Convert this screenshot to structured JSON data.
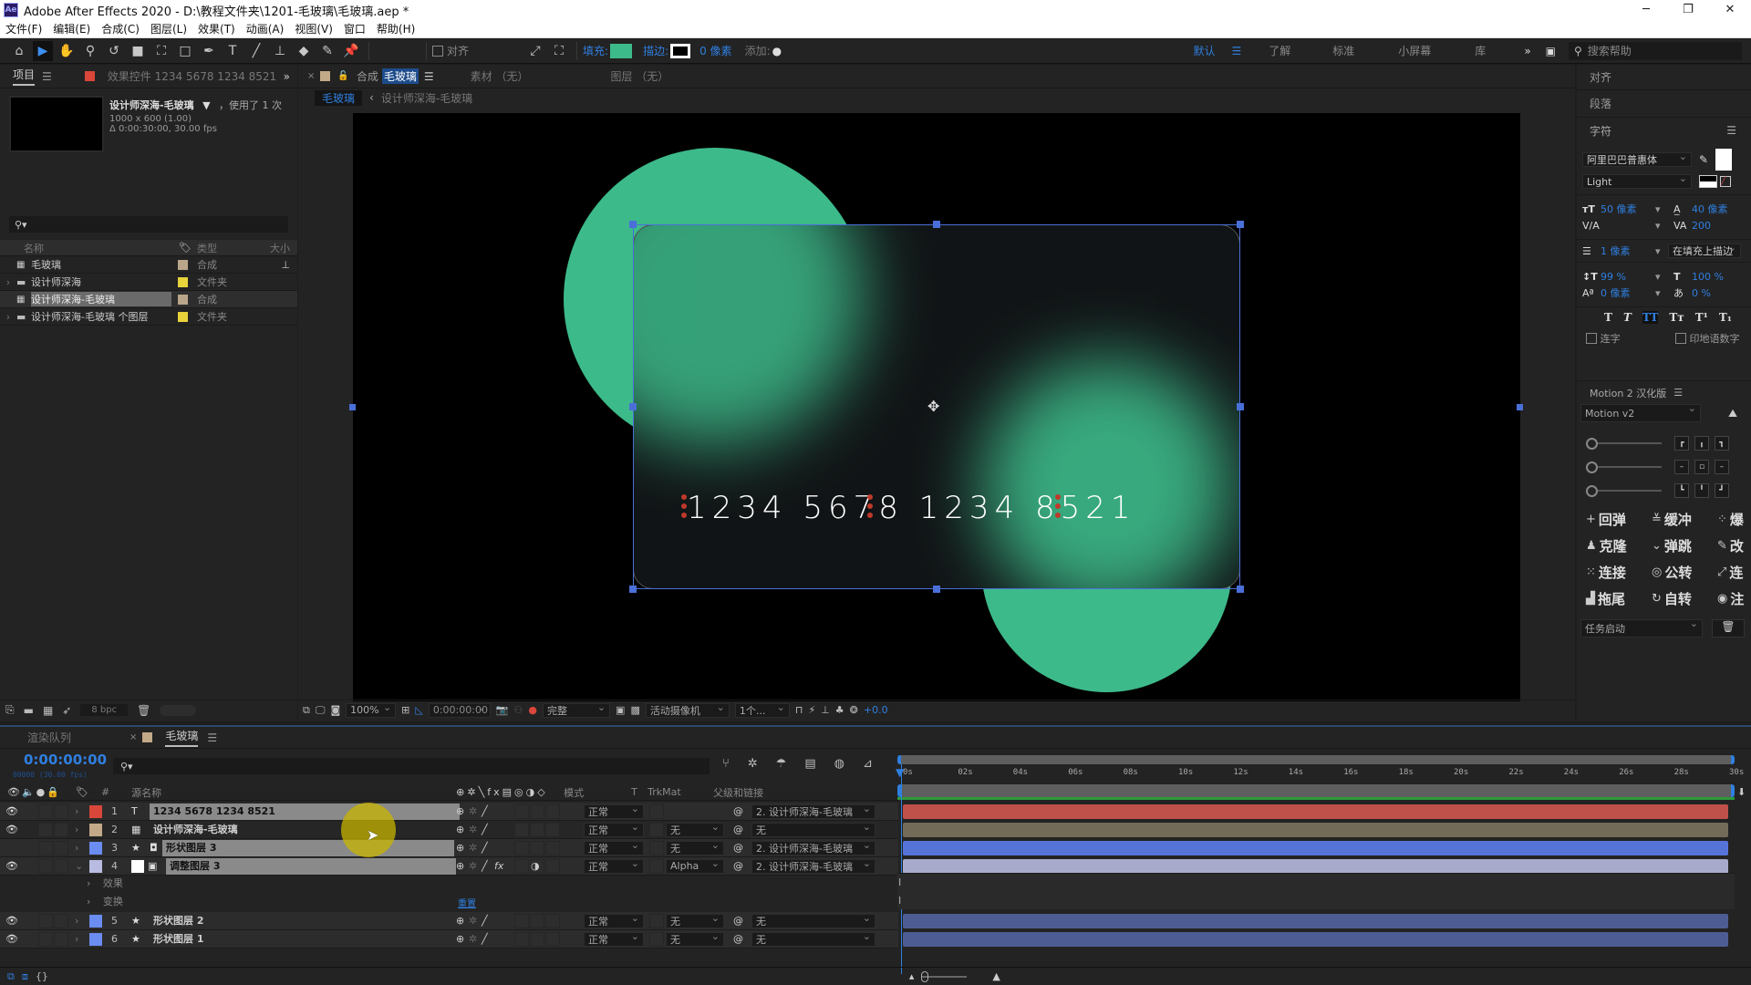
{
  "app": {
    "title": "Adobe After Effects 2020 - D:\\教程文件夹\\1201-毛玻璃\\毛玻璃.aep *",
    "logo": "Ae"
  },
  "window_controls": {
    "minimize": "─",
    "restore": "❐",
    "close": "✕"
  },
  "menu": [
    "文件(F)",
    "编辑(E)",
    "合成(C)",
    "图层(L)",
    "效果(T)",
    "动画(A)",
    "视图(V)",
    "窗口",
    "帮助(H)"
  ],
  "toolbar": {
    "tools": [
      {
        "name": "home-icon",
        "glyph": "⌂"
      },
      {
        "name": "selection-tool-icon",
        "glyph": "▶"
      },
      {
        "name": "hand-tool-icon",
        "glyph": "✋"
      },
      {
        "name": "zoom-tool-icon",
        "glyph": "⚲"
      },
      {
        "name": "rotate-tool-icon",
        "glyph": "↺"
      },
      {
        "name": "camera-tool-icon",
        "glyph": "■"
      },
      {
        "name": "pan-behind-tool-icon",
        "glyph": "⛶"
      },
      {
        "name": "rectangle-tool-icon",
        "glyph": "□"
      },
      {
        "name": "pen-tool-icon",
        "glyph": "✒"
      },
      {
        "name": "type-tool-icon",
        "glyph": "T"
      },
      {
        "name": "brush-tool-icon",
        "glyph": "╱"
      },
      {
        "name": "clone-stamp-tool-icon",
        "glyph": "⊥"
      },
      {
        "name": "eraser-tool-icon",
        "glyph": "◆"
      },
      {
        "name": "roto-brush-tool-icon",
        "glyph": "✎"
      },
      {
        "name": "puppet-pin-tool-icon",
        "glyph": "📌"
      }
    ],
    "align_label": "对齐",
    "fill_label": "填充:",
    "fill_color": "#3dba8a",
    "stroke_label": "描边:",
    "stroke_width": "0 像素",
    "add_label": "添加:",
    "workspaces": [
      "默认",
      "了解",
      "标准",
      "小屏幕",
      "库"
    ],
    "active_workspace": "默认",
    "search_placeholder": "搜索帮助"
  },
  "project_panel": {
    "tab_label": "项目",
    "effects_tab_label": "效果控件 1234 5678 1234 8521",
    "selected_item_name": "设计师深海-毛玻璃",
    "used_count": "，使用了 1 次",
    "dimensions": "1000 x 600 (1.00)",
    "duration": "Δ 0:00:30:00, 30.00 fps",
    "search_placeholder": "",
    "columns": {
      "name": "名称",
      "type": "类型",
      "size": "大小"
    },
    "items": [
      {
        "name": "毛玻璃",
        "type": "合成",
        "icon": "composition-icon",
        "label_color": "#b9a68a",
        "expandable": false
      },
      {
        "name": "设计师深海",
        "type": "文件夹",
        "icon": "folder-icon",
        "label_color": "#e8d33a",
        "expandable": true
      },
      {
        "name": "设计师深海-毛玻璃",
        "type": "合成",
        "icon": "composition-icon",
        "label_color": "#b9a68a",
        "expandable": false,
        "selected": true
      },
      {
        "name": "设计师深海-毛玻璃 个图层",
        "type": "文件夹",
        "icon": "folder-icon",
        "label_color": "#e8d33a",
        "expandable": true
      }
    ],
    "bit_depth": "8 bpc"
  },
  "comp_panel": {
    "tab_prefix": "合成",
    "tab_name": "毛玻璃",
    "footage_tab": "素材 （无）",
    "layer_tab": "图层 （无）",
    "breadcrumb": [
      "毛玻璃",
      "设计师深海-毛玻璃"
    ],
    "card_number": "1234 5678 1234 8521",
    "accent_color": "#3dba8a",
    "footer": {
      "zoom": "100%",
      "timecode": "0:00:00:00",
      "resolution": "完整",
      "camera": "活动摄像机",
      "views": "1个...",
      "exposure": "+0.0"
    }
  },
  "right_panels": {
    "align": "对齐",
    "paragraph": "段落",
    "character": {
      "title": "字符",
      "font": "阿里巴巴普惠体",
      "style": "Light",
      "font_size": "50 像素",
      "leading": "40 像素",
      "kerning": "",
      "tracking": "200",
      "stroke_width": "1 像素",
      "stroke_mode": "在填充上描边",
      "vertical_scale": "99 %",
      "horizontal_scale": "100 %",
      "baseline_shift": "0 像素",
      "tsume": "0 %",
      "style_buttons": [
        "T",
        "T",
        "TT",
        "Tт",
        "T¹",
        "T₁"
      ],
      "ligatures": "连字",
      "hindi_digits": "印地语数字"
    },
    "motion": {
      "title": "Motion 2 汉化版",
      "preset": "Motion v2",
      "buttons": [
        {
          "icon": "+",
          "label": "回弹"
        },
        {
          "icon": "≚",
          "label": "缓冲"
        },
        {
          "icon": "⁘",
          "label": "爆"
        },
        {
          "icon": "♟",
          "label": "克隆"
        },
        {
          "icon": "⌄",
          "label": "弹跳"
        },
        {
          "icon": "✎",
          "label": "改"
        },
        {
          "icon": "⁙",
          "label": "连接"
        },
        {
          "icon": "◎",
          "label": "公转"
        },
        {
          "icon": "⤢",
          "label": "连"
        },
        {
          "icon": "▟",
          "label": "拖尾"
        },
        {
          "icon": "↻",
          "label": "自转"
        },
        {
          "icon": "◉",
          "label": "注"
        }
      ],
      "task": "任务启动"
    }
  },
  "timeline": {
    "render_queue_tab": "渲染队列",
    "comp_tab": "毛玻璃",
    "timecode": "0:00:00:00",
    "frame_info": "00000 (30.00 fps)",
    "columns": {
      "source_name": "源名称",
      "mode": "模式",
      "t": "T",
      "trkmat": "TrkMat",
      "parent": "父级和链接"
    },
    "ruler": [
      "0s",
      "02s",
      "04s",
      "06s",
      "08s",
      "10s",
      "12s",
      "14s",
      "16s",
      "18s",
      "20s",
      "22s",
      "24s",
      "26s",
      "28s",
      "30s"
    ],
    "layers": [
      {
        "num": "1",
        "name": "1234 5678 1234 8521",
        "type_icon": "T",
        "label_color": "#d9463a",
        "visible": true,
        "mode": "正常",
        "trkmat": "",
        "parent": "2. 设计师深海-毛玻璃",
        "bar_color": "#c0504a",
        "selected": true
      },
      {
        "num": "2",
        "name": "设计师深海-毛玻璃",
        "type_icon": "comp",
        "label_color": "#c2a988",
        "visible": true,
        "mode": "正常",
        "trkmat": "无",
        "parent": "无",
        "bar_color": "#736b58",
        "selected": false
      },
      {
        "num": "3",
        "name": "形状图层 3",
        "type_icon": "star",
        "label_color": "#6b8cf0",
        "visible": false,
        "mode": "正常",
        "trkmat": "无",
        "parent": "2. 设计师深海-毛玻璃",
        "bar_color": "#5674d8",
        "selected": true
      },
      {
        "num": "4",
        "name": "调整图层 3",
        "type_icon": "adjust",
        "label_color": "#b9bce0",
        "visible": true,
        "mode": "正常",
        "trkmat": "Alpha",
        "parent": "2. 设计师深海-毛玻璃",
        "bar_color": "#a7aacb",
        "selected": true,
        "expanded": true,
        "props": [
          "效果",
          "变换"
        ],
        "reset": "重置"
      },
      {
        "num": "5",
        "name": "形状图层 2",
        "type_icon": "star",
        "label_color": "#6b8cf0",
        "visible": true,
        "mode": "正常",
        "trkmat": "无",
        "parent": "无",
        "bar_color": "#4d5d94",
        "selected": false
      },
      {
        "num": "6",
        "name": "形状图层 1",
        "type_icon": "star",
        "label_color": "#6b8cf0",
        "visible": true,
        "mode": "正常",
        "trkmat": "无",
        "parent": "无",
        "bar_color": "#4d5d94",
        "selected": false
      }
    ]
  }
}
